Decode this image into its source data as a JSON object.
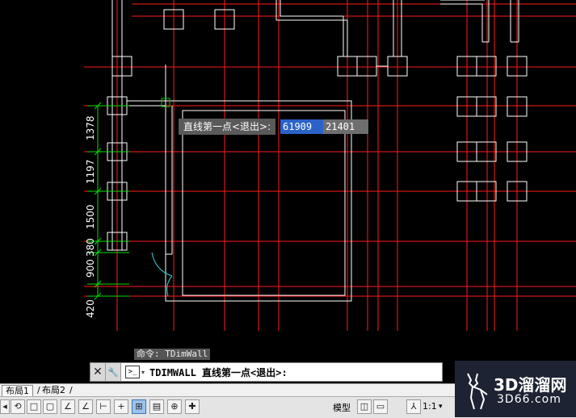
{
  "drawing": {
    "dimension_labels": [
      "1378",
      "1197",
      "1500",
      "900",
      "380",
      "420"
    ]
  },
  "dynamic_input": {
    "prompt": "直线第一点<退出>:",
    "x_value": "61909",
    "y_value": "21401"
  },
  "command": {
    "history": "命令: TDimWall",
    "close_symbol": "✕",
    "wrench_symbol": "🔧",
    "prompt_icon": ">_",
    "caret": "▾",
    "current": "TDIMWALL 直线第一点<退出>:"
  },
  "layout_tabs": {
    "nav_arrow": "◂",
    "items": [
      "布局1",
      "布局2"
    ],
    "separator": "/"
  },
  "status": {
    "model_label": "模型",
    "scale_label": "1:1",
    "scale_caret": "▾",
    "colors": {
      "accent": "#3a76b8",
      "active_toggle": "#9cc3ea"
    }
  },
  "watermark": {
    "cn": "3D溜溜网",
    "url": "3D66.com"
  },
  "colors": {
    "grid_line": "#ff1a1a",
    "wall": "#ffffff",
    "dimension": "#00e000",
    "snap_marker": "#00cc00",
    "door": "#2fd3d3",
    "input_highlight": "#2b62c8"
  }
}
